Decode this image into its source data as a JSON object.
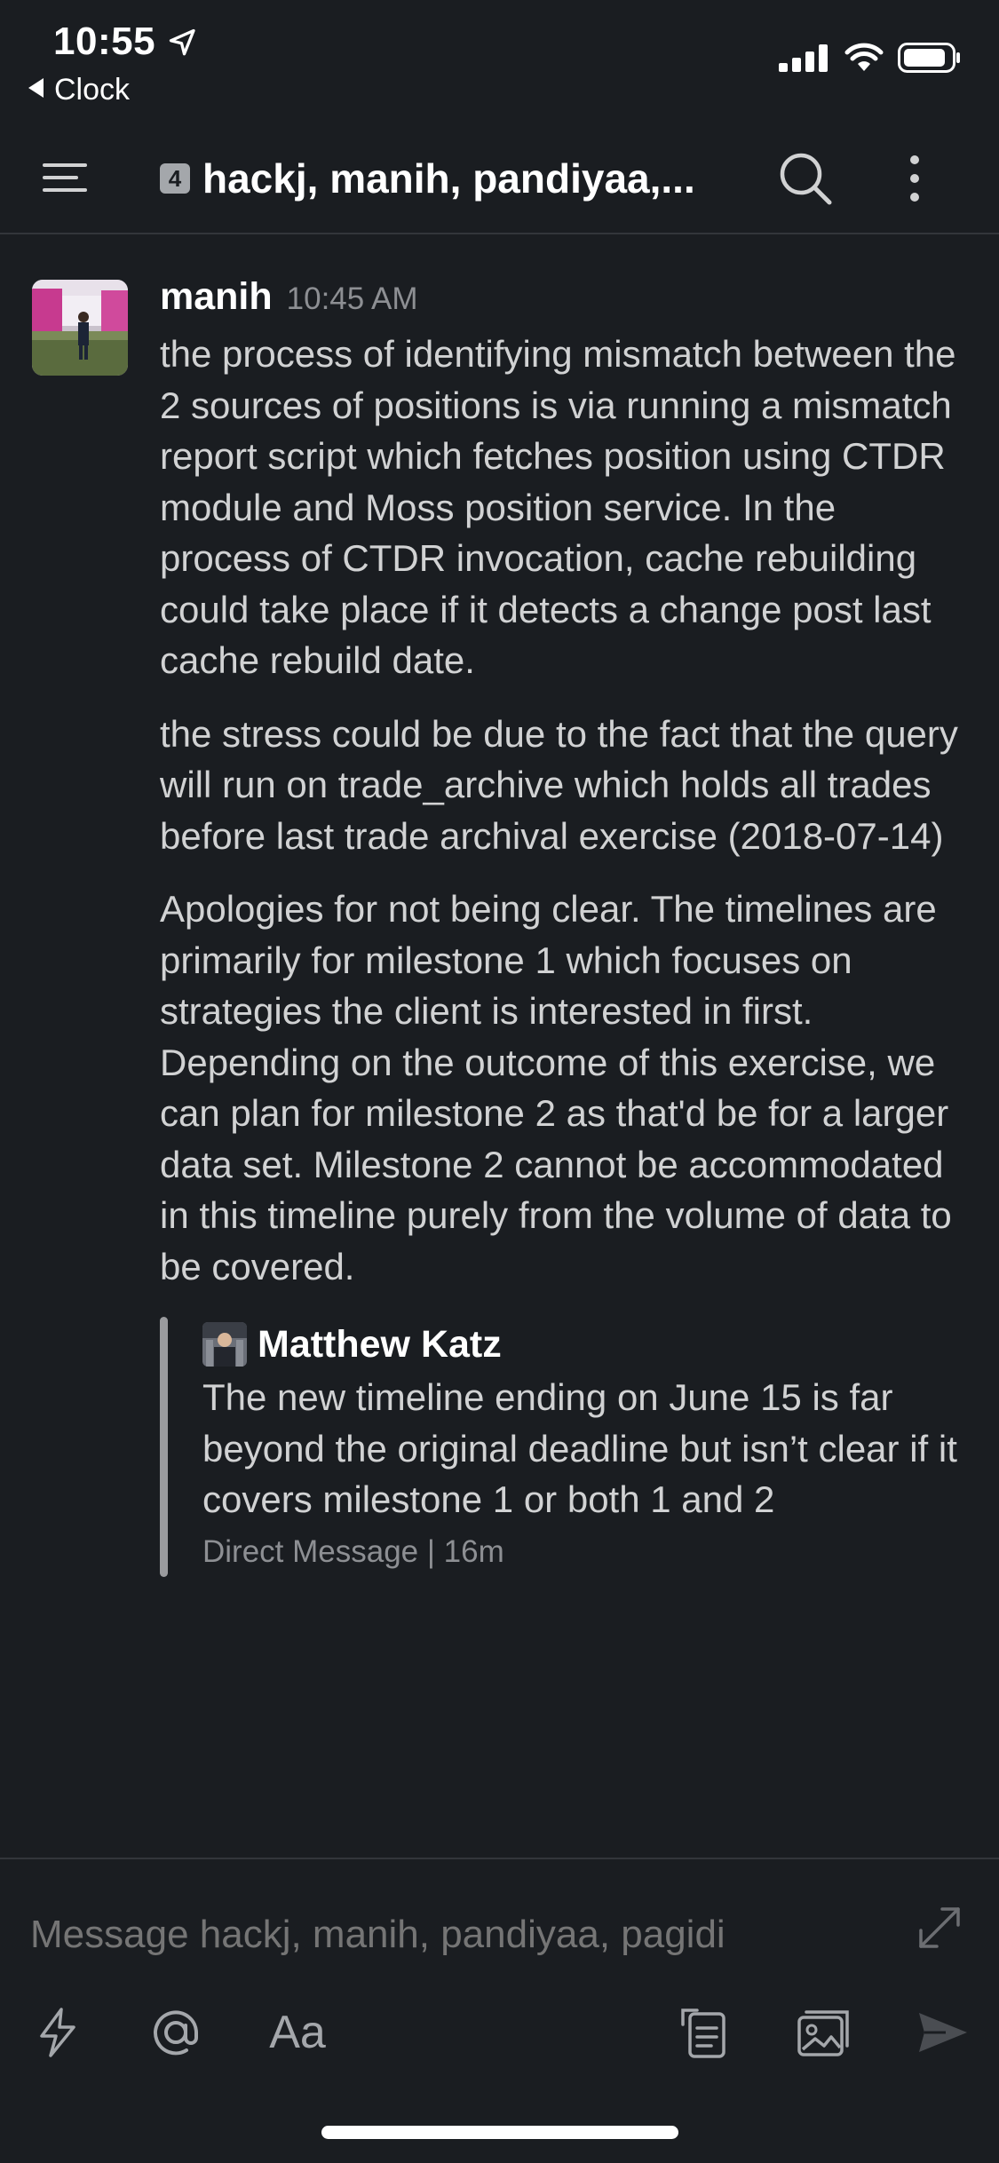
{
  "status_bar": {
    "time": "10:55",
    "back_label": "Clock"
  },
  "header": {
    "member_count": "4",
    "title": "hackj, manih, pandiyaa,..."
  },
  "message": {
    "author": "manih",
    "timestamp": "10:45 AM",
    "paragraphs": [
      "the process of identifying mismatch between the 2 sources of positions is via running a mismatch report script which fetches position using CTDR module and Moss position service. In the process of CTDR invocation, cache rebuilding could take place if it detects a change post last cache rebuild date.",
      "the stress could be due to the fact that the query will run on trade_archive which holds all trades before last trade archival exercise (2018-07-14)",
      "Apologies for not being clear. The timelines are primarily for milestone 1 which focuses on strategies the client is interested in first. Depending on the outcome of this exercise, we can plan for milestone 2 as that'd be for a larger data set. Milestone 2 cannot be accommodated in this timeline purely from the volume of data to be covered."
    ],
    "shared": {
      "author": "Matthew Katz",
      "text": "The new timeline ending on June 15 is far beyond the original deadline but isn’t clear if it covers milestone 1 or both 1 and 2",
      "meta": "Direct Message | 16m"
    }
  },
  "composer": {
    "placeholder": "Message hackj, manih, pandiyaa, pagidi",
    "format_label": "Aa"
  },
  "colors": {
    "background": "#1a1d21",
    "text_primary": "#ffffff",
    "text_body": "#d1d2d3",
    "text_muted": "#8d8f93",
    "divider": "#33363b"
  }
}
